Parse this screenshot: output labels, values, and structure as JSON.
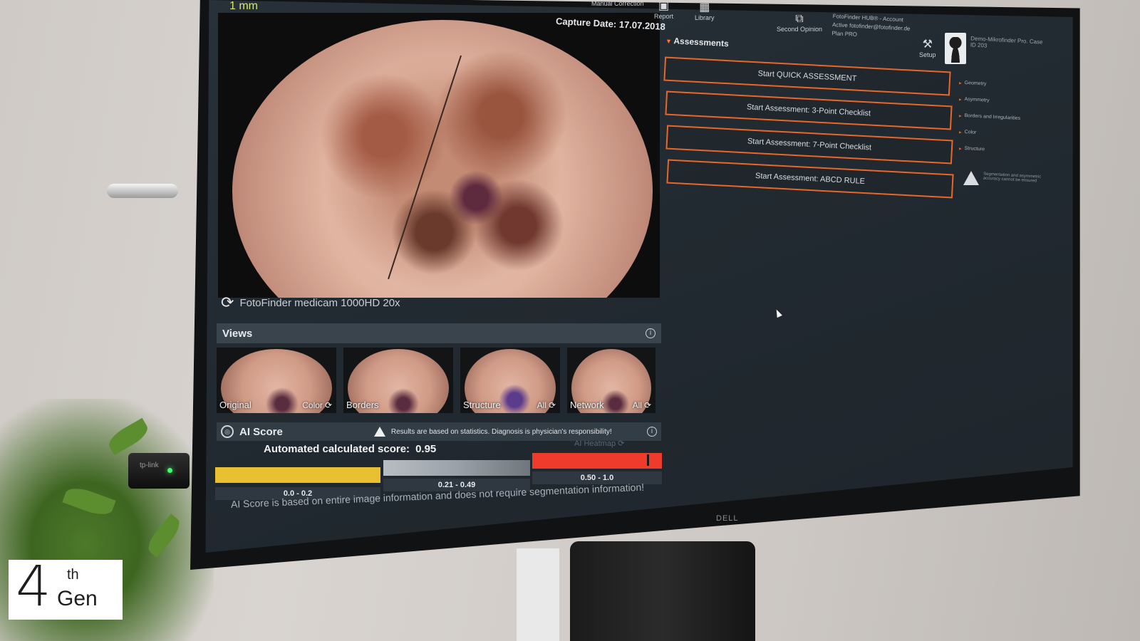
{
  "scale_label": "1 mm",
  "capture_date": "Capture Date: 17.07.2018",
  "camera": "FotoFinder medicam 1000HD 20x",
  "toolbar": {
    "manual_correction": "Manual Correction",
    "report": "Report",
    "library": "Library",
    "second_opinion": "Second Opinion",
    "account_line": "FotoFinder HUB® - Account",
    "account_active": "Active",
    "account_user": "fotofinder@fotofinder.de",
    "account_plan_label": "Plan",
    "account_plan": "PRO",
    "setup": "Setup",
    "patient_name": "Demo-Mikrofinder Pro. Case",
    "patient_id": "ID 203"
  },
  "views": {
    "title": "Views",
    "thumbs": [
      {
        "label": "Original",
        "right": ""
      },
      {
        "label": "",
        "right": "Color"
      },
      {
        "label": "Borders",
        "right": ""
      },
      {
        "label": "Structure",
        "right": "All"
      },
      {
        "label": "Network",
        "right": "All"
      }
    ]
  },
  "ai_score": {
    "title": "AI Score",
    "warning": "Results are based on statistics. Diagnosis is physician's responsibility!",
    "score_label": "Automated calculated score:",
    "score_value": "0.95",
    "heatmap": "AI Heatmap",
    "ranges": [
      "0.0 - 0.2",
      "0.21 - 0.49",
      "0.50 - 1.0"
    ],
    "range_colors": [
      "#e8c031",
      "#9aa1a8",
      "#ee3b2b"
    ],
    "score": 0.95,
    "note": "AI Score is based on entire image information and does not require segmentation information!"
  },
  "assessments": {
    "title": "Assessments",
    "buttons": [
      "Start QUICK ASSESSMENT",
      "Start Assessment: 3-Point Checklist",
      "Start Assessment: 7-Point Checklist",
      "Start Assessment: ABCD RULE"
    ],
    "side_items": [
      "Geometry",
      "Asymmetry",
      "Borders and Irregularities",
      "Color",
      "Structure"
    ],
    "side_warning": "Segmentation and asymmetric accuracy cannot be ensured"
  },
  "monitor_brand": "DELL",
  "usb_brand": "tp-link",
  "logo": {
    "four": "4",
    "th": "th",
    "gen": "Gen"
  }
}
